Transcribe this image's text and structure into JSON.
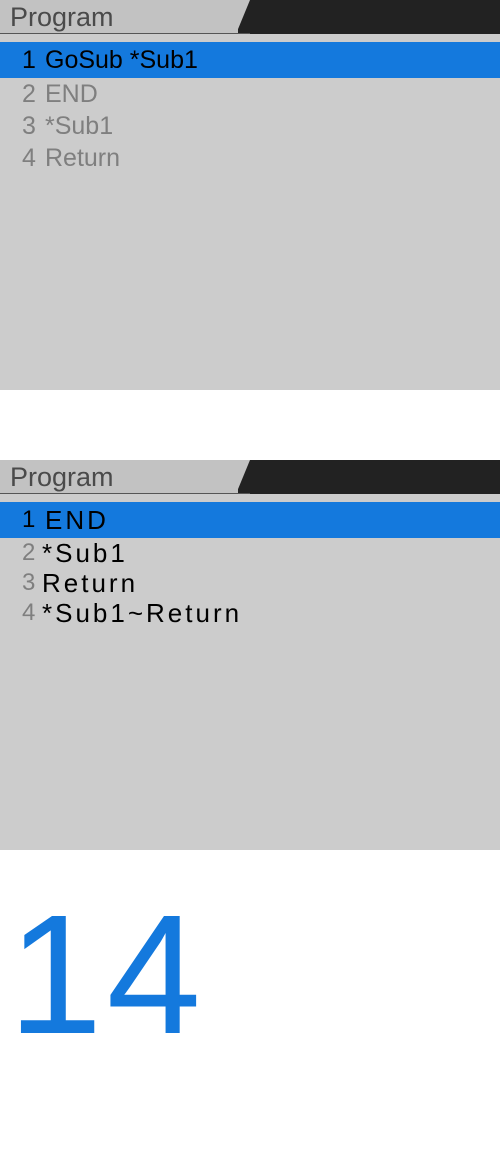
{
  "accent_color": "#1479dd",
  "panels": [
    {
      "title": "Program",
      "rows": [
        {
          "num": "1",
          "code": "GoSub *Sub1",
          "selected": true
        },
        {
          "num": "2",
          "code": "END",
          "selected": false
        },
        {
          "num": "3",
          "code": "*Sub1",
          "selected": false
        },
        {
          "num": "4",
          "code": "Return",
          "selected": false
        }
      ]
    },
    {
      "title": "Program",
      "rows": [
        {
          "num": "1",
          "code": "END",
          "selected": true
        },
        {
          "num": "2",
          "code": "*Sub1",
          "selected": false
        },
        {
          "num": "3",
          "code": "Return",
          "selected": false
        },
        {
          "num": "4",
          "code": "*Sub1~Return",
          "selected": false
        }
      ]
    }
  ],
  "page_number": "14"
}
